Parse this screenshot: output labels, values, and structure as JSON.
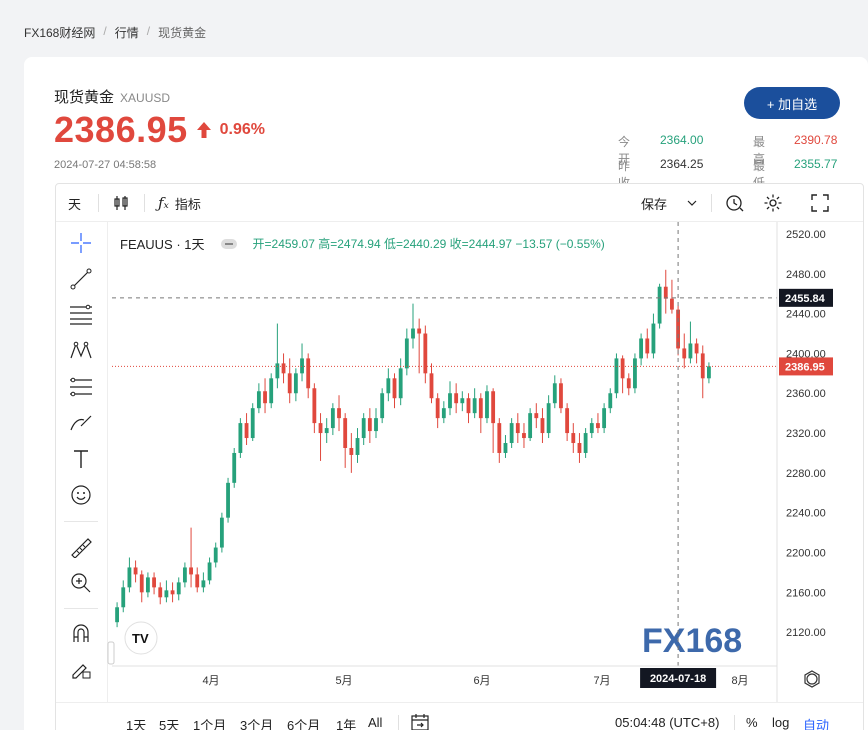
{
  "breadcrumb": [
    "FX168财经网",
    "行情",
    "现货黄金"
  ],
  "header": {
    "title": "现货黄金",
    "symbol": "XAUUSD",
    "price": "2386.95",
    "change_pct": "0.96%",
    "timestamp": "2024-07-27 04:58:58",
    "add_button": "+ 加自选"
  },
  "stats": {
    "open_label": "今开",
    "open": "2364.00",
    "high_label": "最高",
    "high": "2390.78",
    "prev_label": "昨收",
    "prev": "2364.25",
    "low_label": "最低",
    "low": "2355.77"
  },
  "toolbar": {
    "interval": "天",
    "indicators": "指标",
    "save": "保存"
  },
  "legend": {
    "symbol": "FEAUUS · 1天",
    "text": "开=2459.07 高=2474.94 低=2440.29 收=2444.97 −13.57 (−0.55%)"
  },
  "bottombar": {
    "ranges": [
      "1天",
      "5天",
      "1个月",
      "3个月",
      "6个月",
      "1年",
      "All"
    ],
    "clock": "05:04:48 (UTC+8)",
    "pct": "%",
    "log": "log",
    "auto": "自动"
  },
  "colors": {
    "up": "#26a17b",
    "down": "#e0483d",
    "brand": "#1b4f9c"
  },
  "chart_data": {
    "type": "candlestick",
    "x_ticks": [
      "4月",
      "5月",
      "6月",
      "7月",
      "8月"
    ],
    "y_ticks": [
      "2520.00",
      "2480.00",
      "2440.00",
      "2400.00",
      "2360.00",
      "2320.00",
      "2280.00",
      "2240.00",
      "2200.00",
      "2160.00",
      "2120.00"
    ],
    "ylim": [
      2086,
      2528
    ],
    "crosshair_price": "2455.84",
    "last_price": "2386.95",
    "crosshair_date": "2024-07-18",
    "watermark": "FX168",
    "candles": [
      [
        2130,
        2145,
        2125,
        2150
      ],
      [
        2145,
        2165,
        2140,
        2172
      ],
      [
        2165,
        2185,
        2160,
        2195
      ],
      [
        2185,
        2178,
        2170,
        2192
      ],
      [
        2178,
        2160,
        2150,
        2182
      ],
      [
        2160,
        2175,
        2155,
        2180
      ],
      [
        2175,
        2165,
        2158,
        2180
      ],
      [
        2165,
        2155,
        2148,
        2170
      ],
      [
        2155,
        2162,
        2150,
        2172
      ],
      [
        2162,
        2158,
        2150,
        2170
      ],
      [
        2158,
        2170,
        2152,
        2175
      ],
      [
        2170,
        2185,
        2165,
        2190
      ],
      [
        2185,
        2178,
        2165,
        2225
      ],
      [
        2178,
        2165,
        2160,
        2185
      ],
      [
        2165,
        2172,
        2160,
        2180
      ],
      [
        2172,
        2190,
        2168,
        2195
      ],
      [
        2190,
        2205,
        2185,
        2210
      ],
      [
        2205,
        2235,
        2200,
        2240
      ],
      [
        2235,
        2270,
        2230,
        2275
      ],
      [
        2270,
        2300,
        2265,
        2305
      ],
      [
        2300,
        2330,
        2295,
        2335
      ],
      [
        2330,
        2315,
        2308,
        2340
      ],
      [
        2315,
        2345,
        2312,
        2350
      ],
      [
        2345,
        2362,
        2340,
        2370
      ],
      [
        2362,
        2350,
        2340,
        2375
      ],
      [
        2350,
        2375,
        2345,
        2380
      ],
      [
        2375,
        2390,
        2365,
        2430
      ],
      [
        2390,
        2380,
        2370,
        2400
      ],
      [
        2380,
        2360,
        2350,
        2395
      ],
      [
        2360,
        2380,
        2352,
        2385
      ],
      [
        2380,
        2395,
        2372,
        2410
      ],
      [
        2395,
        2365,
        2355,
        2400
      ],
      [
        2365,
        2330,
        2320,
        2370
      ],
      [
        2330,
        2320,
        2292,
        2340
      ],
      [
        2320,
        2325,
        2310,
        2335
      ],
      [
        2325,
        2345,
        2318,
        2350
      ],
      [
        2345,
        2335,
        2322,
        2358
      ],
      [
        2335,
        2305,
        2285,
        2340
      ],
      [
        2305,
        2298,
        2280,
        2320
      ],
      [
        2298,
        2315,
        2290,
        2325
      ],
      [
        2315,
        2335,
        2308,
        2340
      ],
      [
        2335,
        2322,
        2310,
        2345
      ],
      [
        2322,
        2335,
        2315,
        2345
      ],
      [
        2335,
        2360,
        2330,
        2365
      ],
      [
        2360,
        2375,
        2352,
        2385
      ],
      [
        2375,
        2355,
        2345,
        2380
      ],
      [
        2355,
        2385,
        2348,
        2395
      ],
      [
        2385,
        2415,
        2378,
        2425
      ],
      [
        2415,
        2425,
        2405,
        2450
      ],
      [
        2425,
        2420,
        2380,
        2435
      ],
      [
        2420,
        2380,
        2370,
        2428
      ],
      [
        2380,
        2355,
        2350,
        2390
      ],
      [
        2355,
        2335,
        2325,
        2360
      ],
      [
        2335,
        2345,
        2330,
        2352
      ],
      [
        2345,
        2360,
        2338,
        2372
      ],
      [
        2360,
        2350,
        2340,
        2370
      ],
      [
        2350,
        2355,
        2342,
        2362
      ],
      [
        2355,
        2340,
        2330,
        2360
      ],
      [
        2340,
        2355,
        2335,
        2365
      ],
      [
        2355,
        2335,
        2320,
        2360
      ],
      [
        2335,
        2362,
        2330,
        2368
      ],
      [
        2362,
        2330,
        2300,
        2365
      ],
      [
        2330,
        2300,
        2290,
        2335
      ],
      [
        2300,
        2310,
        2295,
        2318
      ],
      [
        2310,
        2330,
        2305,
        2335
      ],
      [
        2330,
        2320,
        2310,
        2340
      ],
      [
        2320,
        2315,
        2305,
        2330
      ],
      [
        2315,
        2340,
        2312,
        2345
      ],
      [
        2340,
        2335,
        2325,
        2350
      ],
      [
        2335,
        2320,
        2310,
        2345
      ],
      [
        2320,
        2350,
        2315,
        2358
      ],
      [
        2350,
        2370,
        2345,
        2378
      ],
      [
        2370,
        2345,
        2340,
        2375
      ],
      [
        2345,
        2320,
        2312,
        2350
      ],
      [
        2320,
        2310,
        2300,
        2330
      ],
      [
        2310,
        2300,
        2290,
        2320
      ],
      [
        2300,
        2320,
        2295,
        2325
      ],
      [
        2320,
        2330,
        2315,
        2335
      ],
      [
        2330,
        2325,
        2320,
        2340
      ],
      [
        2325,
        2345,
        2320,
        2350
      ],
      [
        2345,
        2360,
        2340,
        2365
      ],
      [
        2360,
        2395,
        2355,
        2400
      ],
      [
        2395,
        2375,
        2360,
        2398
      ],
      [
        2375,
        2365,
        2358,
        2380
      ],
      [
        2365,
        2395,
        2360,
        2400
      ],
      [
        2395,
        2415,
        2388,
        2420
      ],
      [
        2415,
        2400,
        2395,
        2425
      ],
      [
        2400,
        2430,
        2395,
        2440
      ],
      [
        2430,
        2467,
        2425,
        2470
      ],
      [
        2467,
        2455,
        2440,
        2484
      ],
      [
        2455,
        2444,
        2440,
        2474
      ],
      [
        2444,
        2405,
        2398,
        2448
      ],
      [
        2405,
        2395,
        2385,
        2420
      ],
      [
        2395,
        2410,
        2390,
        2432
      ],
      [
        2410,
        2400,
        2390,
        2415
      ],
      [
        2400,
        2375,
        2355,
        2408
      ],
      [
        2375,
        2387,
        2370,
        2391
      ]
    ]
  }
}
